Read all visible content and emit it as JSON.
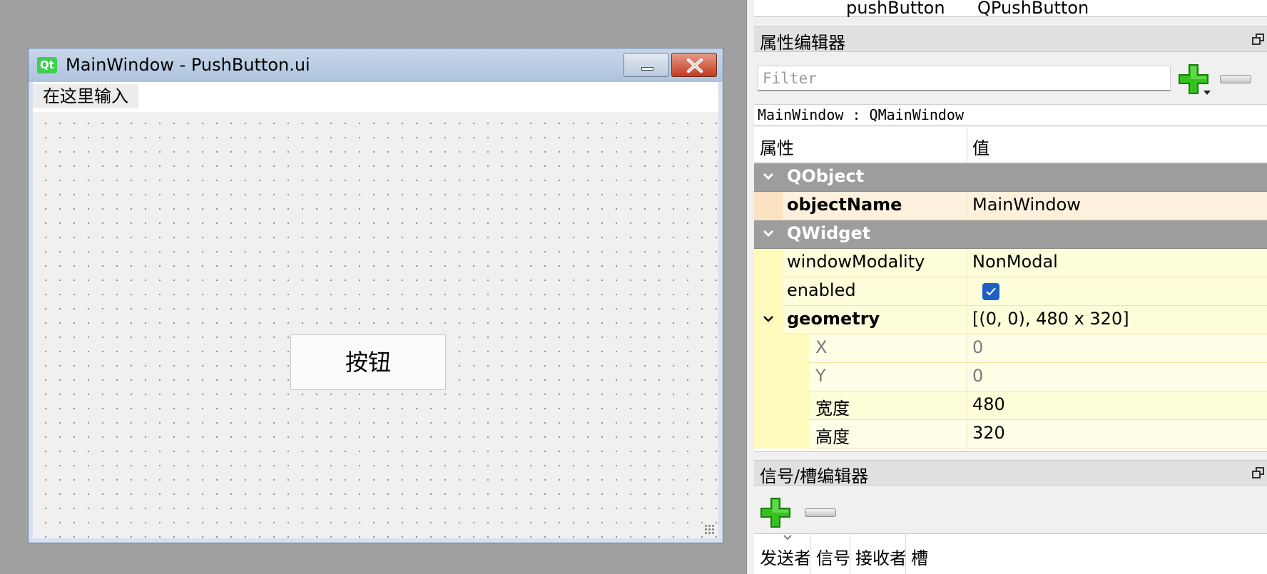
{
  "form_window": {
    "logo_text": "Qt",
    "title": "MainWindow - PushButton.ui",
    "menu_placeholder": "在这里输入",
    "push_button_label": "按钮"
  },
  "object_inspector": {
    "object_name": "pushButton",
    "class_name": "QPushButton"
  },
  "property_editor": {
    "title": "属性编辑器",
    "filter_placeholder": "Filter",
    "class_label": "MainWindow : QMainWindow",
    "header": {
      "property": "属性",
      "value": "值"
    },
    "groups": {
      "qobject": "QObject",
      "qwidget": "QWidget"
    },
    "rows": {
      "object_name": {
        "name": "objectName",
        "value": "MainWindow"
      },
      "window_modality": {
        "name": "windowModality",
        "value": "NonModal"
      },
      "enabled": {
        "name": "enabled",
        "checked": true
      },
      "geometry": {
        "name": "geometry",
        "value": "[(0, 0), 480 x 320]"
      },
      "x": {
        "name": "X",
        "value": "0"
      },
      "y": {
        "name": "Y",
        "value": "0"
      },
      "width": {
        "name": "宽度",
        "value": "480"
      },
      "height": {
        "name": "高度",
        "value": "320"
      }
    }
  },
  "signal_slot_editor": {
    "title": "信号/槽编辑器",
    "columns": [
      "发送者",
      "信号",
      "接收者",
      "槽"
    ]
  },
  "icons": [
    "qt-logo-icon",
    "minimize-icon",
    "close-icon",
    "float-icon",
    "plus-icon",
    "minus-icon",
    "chevron-down-icon",
    "checkbox-checked-icon",
    "resize-grip-icon",
    "sort-indicator-icon"
  ],
  "colors": {
    "group_row": "#9d9d9d",
    "modified_row": "#fdf0dd",
    "property_row": "#fdfdd9",
    "checkbox": "#1d5fc4",
    "plus_green": "#34c21f"
  }
}
